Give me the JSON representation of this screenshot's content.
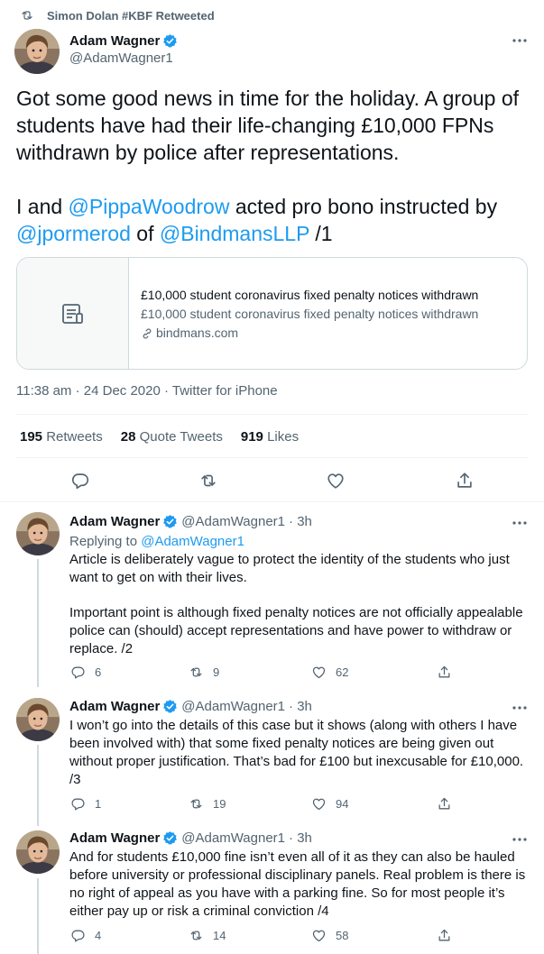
{
  "retweet_header": {
    "text": "Simon Dolan #KBF Retweeted",
    "icon": "retweet-icon"
  },
  "main_tweet": {
    "name": "Adam Wagner",
    "handle": "@AdamWagner1",
    "text_line1": "Got some good news in time for the holiday. A group of students have had their life-changing £10,000 FPNs withdrawn by police after representations.",
    "text_p2_a": "I and ",
    "mention_1": "@PippaWoodrow",
    "text_p2_b": " acted pro bono instructed by ",
    "mention_2": "@jpormerod",
    "text_p2_c": " of ",
    "mention_3": "@BindmansLLP",
    "text_p2_d": " /1",
    "card": {
      "title": "£10,000 student coronavirus fixed penalty notices withdrawn",
      "description": "£10,000 student coronavirus fixed penalty notices withdrawn",
      "domain": "bindmans.com"
    },
    "meta": "11:38 am · 24 Dec 2020 · Twitter for iPhone",
    "stats": {
      "retweets_num": "195",
      "retweets_label": " Retweets",
      "quotes_num": "28",
      "quotes_label": " Quote Tweets",
      "likes_num": "919",
      "likes_label": " Likes"
    }
  },
  "replies": [
    {
      "name": "Adam Wagner",
      "handle": "@AdamWagner1",
      "time": "· 3h",
      "replying_prefix": "Replying to ",
      "replying_to": "@AdamWagner1",
      "para1": "Article is deliberately vague to protect the identity of the students who just want to get on with their lives.",
      "para2": "Important point is although fixed penalty notices are not officially appealable police can (should) accept representations and have power to withdraw or replace. /2",
      "replies_count": "6",
      "retweets_count": "9",
      "likes_count": "62"
    },
    {
      "name": "Adam Wagner",
      "handle": "@AdamWagner1",
      "time": "· 3h",
      "para1": "I won’t go into the details of this case but it shows (along with others I have been involved with) that some fixed penalty notices are being given out without proper justification. That’s bad for £100 but inexcusable for £10,000. /3",
      "replies_count": "1",
      "retweets_count": "19",
      "likes_count": "94"
    },
    {
      "name": "Adam Wagner",
      "handle": "@AdamWagner1",
      "time": "· 3h",
      "para1": "And for students £10,000 fine isn’t even all of it as they can also be hauled before university or professional disciplinary panels. Real problem is there is no right of appeal as you have with a parking fine. So for most people it’s either pay up or risk a criminal conviction /4",
      "replies_count": "4",
      "retweets_count": "14",
      "likes_count": "58"
    }
  ],
  "colors": {
    "accent": "#1d9bf0",
    "muted": "#536471",
    "border": "#cfd9de"
  }
}
